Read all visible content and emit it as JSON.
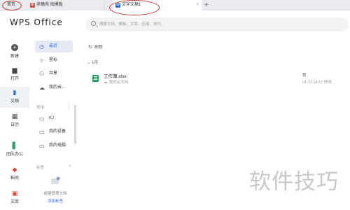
{
  "tabs": [
    {
      "label": "首页"
    },
    {
      "label": "来稿壳 找模版"
    },
    {
      "label": "文字文稿1"
    }
  ],
  "tab_close": "×",
  "tab_add": "+",
  "header": {
    "logo": "WPS Office",
    "search_placeholder": "搜索文档、模板、文库、应用、技巧..."
  },
  "rail": [
    {
      "label": "新建",
      "icon": "plus-icon"
    },
    {
      "label": "打开",
      "icon": "folder-icon"
    },
    {
      "label": "文档",
      "icon": "document-icon",
      "active": true
    },
    {
      "label": "日历",
      "icon": "calendar-icon"
    },
    {
      "label": "团队办公",
      "icon": "team-icon"
    },
    {
      "label": "稻壳",
      "icon": "daoke-icon"
    },
    {
      "label": "文库",
      "icon": "library-icon"
    }
  ],
  "nav": {
    "recent": "最近",
    "starred": "星标",
    "shared": "共享",
    "cloud": "我的云...",
    "section_common": "常用",
    "kj": "KJ",
    "my_device": "我的设备",
    "my_computer": "我的电脑",
    "section_tags": "标签",
    "empty_text": "便捷管理文档",
    "add_tag": "添加标签"
  },
  "main": {
    "refresh": "刷新",
    "month": "1月",
    "files": [
      {
        "name": "工作簿.xlsx",
        "location": "我的云文档",
        "owner": "我",
        "time": "01-13 14:57 修改"
      }
    ]
  },
  "watermark": "软件技巧",
  "colors": {
    "accent": "#2f6fe8",
    "sheet": "#29a366",
    "annotation": "#c0392b"
  }
}
